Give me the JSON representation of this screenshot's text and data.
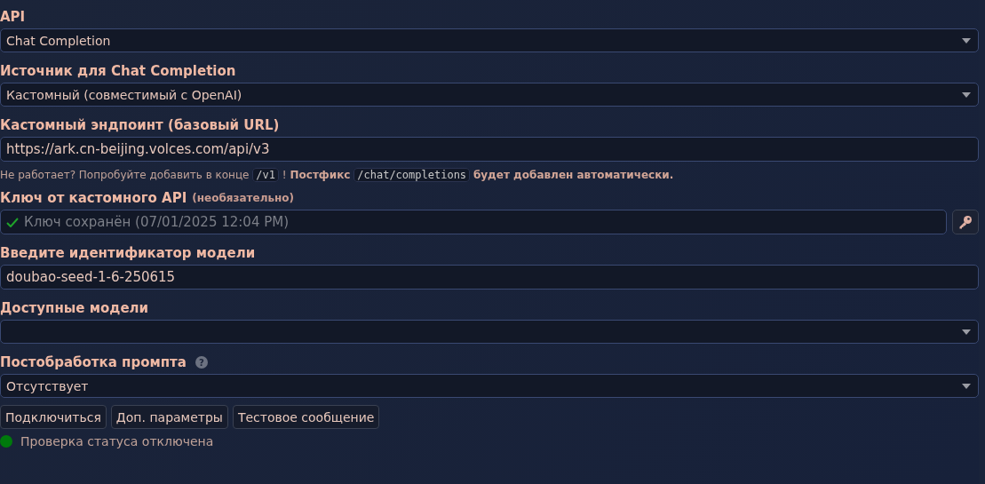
{
  "rows": [
    {
      "kind": "label",
      "text": "API"
    },
    {
      "kind": "select",
      "value": "Chat Completion"
    },
    {
      "kind": "label",
      "text": "Источник для Chat Completion"
    },
    {
      "kind": "select",
      "value": "Кастомный (совместимый с OpenAI)"
    },
    {
      "kind": "label",
      "text": "Кастомный эндпоинт (базовый URL)"
    },
    {
      "kind": "input",
      "value": "https://ark.cn-beijing.volces.com/api/v3"
    },
    {
      "kind": "hint",
      "parts": [
        {
          "kind": "text",
          "text": "Не работает? Попробуйте добавить в конце"
        },
        {
          "kind": "code",
          "text": "/v1"
        },
        {
          "kind": "text",
          "text": "!"
        },
        {
          "kind": "bold",
          "text": "Постфикс"
        },
        {
          "kind": "code",
          "text": "/chat/completions"
        },
        {
          "kind": "bold",
          "text": "будет добавлен автоматически."
        }
      ]
    },
    {
      "kind": "label",
      "text": "Ключ от кастомного API",
      "note": "(необязательно)"
    },
    {
      "kind": "key",
      "placeholder": "Ключ сохранён (07/01/2025 12:04 PM)"
    },
    {
      "kind": "label",
      "text": "Введите идентификатор модели"
    },
    {
      "kind": "input",
      "value": "doubao-seed-1-6-250615"
    },
    {
      "kind": "label",
      "text": "Доступные модели"
    },
    {
      "kind": "select",
      "value": ""
    },
    {
      "kind": "label",
      "text": "Постобработка промпта",
      "help": "?"
    },
    {
      "kind": "select",
      "value": "Отсутствует"
    },
    {
      "kind": "buttons",
      "items": [
        "Подключиться",
        "Доп. параметры",
        "Тестовое сообщение"
      ]
    },
    {
      "kind": "status",
      "text": "Проверка статуса отключена",
      "color": "#007a0c"
    }
  ]
}
